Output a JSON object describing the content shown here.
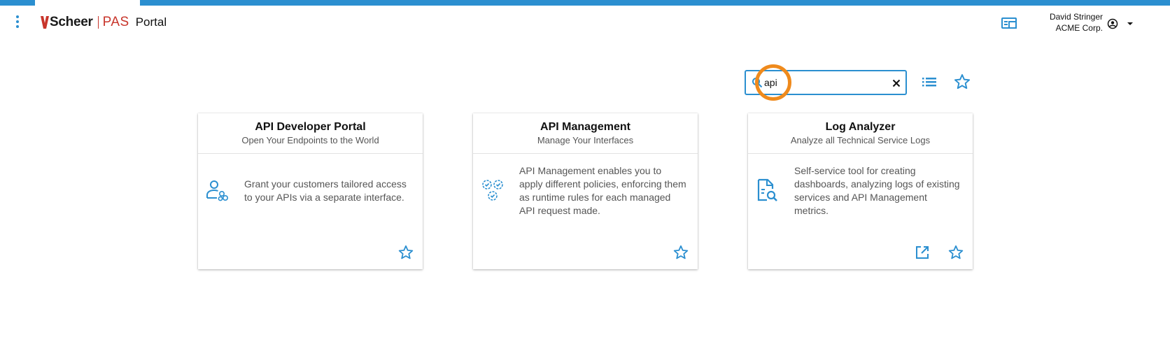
{
  "header": {
    "brand_name": "Scheer",
    "brand_product": "PAS",
    "app_title": "Portal",
    "user_name": "David Stringer",
    "user_company": "ACME Corp."
  },
  "search": {
    "value": "api",
    "placeholder": ""
  },
  "cards": [
    {
      "title": "API Developer Portal",
      "subtitle": "Open Your Endpoints to the World",
      "description": "Grant your customers tailored access to your APIs via a separate interface.",
      "icon": "user-settings-icon"
    },
    {
      "title": "API Management",
      "subtitle": "Manage Your Interfaces",
      "description": "API Management enables you to apply different policies, enforcing them as runtime rules for each managed API request made.",
      "icon": "gears-check-icon"
    },
    {
      "title": "Log Analyzer",
      "subtitle": "Analyze all Technical Service Logs",
      "description": "Self-service tool for creating dashboards, analyzing logs of existing services and API Management metrics.",
      "icon": "document-search-icon"
    }
  ],
  "colors": {
    "accent": "#2b8fd0",
    "brand_red": "#c8352b",
    "highlight_ring": "#ef8a1c"
  }
}
